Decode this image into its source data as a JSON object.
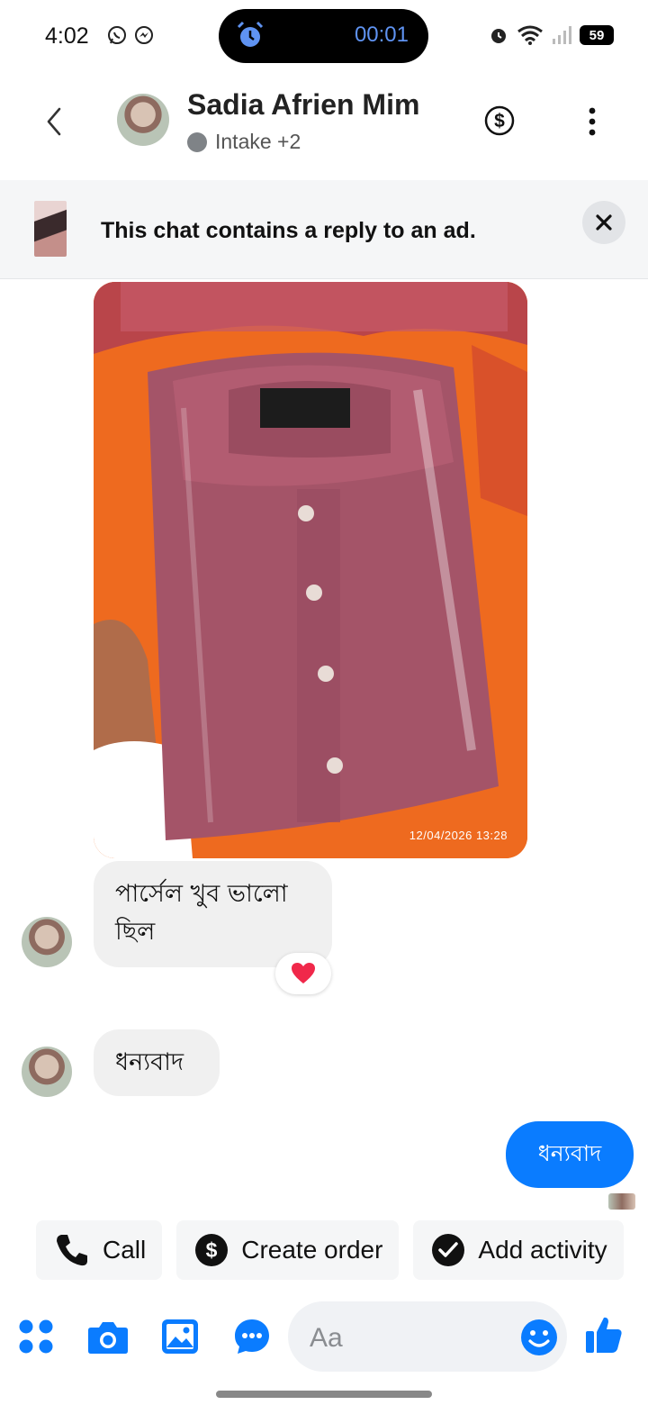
{
  "status_bar": {
    "time": "4:02",
    "timer": "00:01",
    "battery": "59"
  },
  "header": {
    "name": "Sadia Afrien Mim",
    "label": "Intake +2"
  },
  "ad_banner": {
    "text": "This chat contains a reply to an ad."
  },
  "photo": {
    "timestamp": "12/04/2026  13:28"
  },
  "messages": [
    {
      "direction": "incoming",
      "text": "পার্সেল খুব ভালো ছিল",
      "reaction": "heart"
    },
    {
      "direction": "incoming",
      "text": "ধন্যবাদ"
    },
    {
      "direction": "outgoing",
      "text": "ধন্যবাদ"
    }
  ],
  "quick_actions": {
    "call": "Call",
    "create_order": "Create order",
    "add_activity": "Add activity"
  },
  "composer": {
    "placeholder": "Aa"
  },
  "colors": {
    "accent": "#0a7cff",
    "incoming_bubble": "#f0f0f0"
  }
}
